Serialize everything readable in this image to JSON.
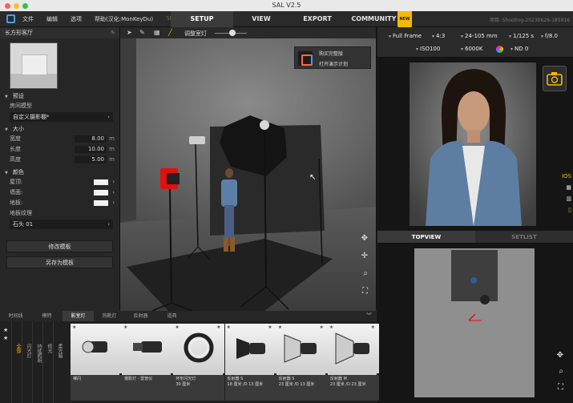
{
  "window": {
    "title": "SAL V2.5"
  },
  "menu": {
    "items": [
      "文件",
      "编辑",
      "选项",
      "帮助(汉化:MonKeyDu)",
      "SFX"
    ]
  },
  "tabs": [
    {
      "label": "SETUP",
      "active": true
    },
    {
      "label": "VIEW",
      "active": false
    },
    {
      "label": "EXPORT",
      "active": false
    },
    {
      "label": "COMMUNITY",
      "active": false,
      "badge": "NEW"
    }
  ],
  "project_name": "项目: Shooting-20230626-185916",
  "left_panel": {
    "header": "长方形客厅",
    "sec_preset": "预设",
    "room_model_label": "房间模型",
    "room_model_value": "自定义摄影棚*",
    "sec_size": "大小",
    "width_label": "宽度",
    "width_value": "8.00",
    "length_label": "长度",
    "length_value": "10.00",
    "height_label": "高度",
    "height_value": "5.00",
    "unit": "m",
    "sec_color": "颜色",
    "ceiling_label": "屋顶:",
    "wall_label": "墙面:",
    "floor_label": "地板:",
    "floor_texture_label": "地板纹理",
    "floor_texture_value": "石头 01",
    "modify_btn": "修改模板",
    "save_as_btn": "另存为模板"
  },
  "viewport": {
    "toolbar_label": "调整室灯",
    "popup_buy": "购买完整版",
    "popup_demo": "打开演示计划"
  },
  "camera_settings": {
    "format": "Full Frame",
    "ratio": "4:3",
    "lens": "24-105 mm",
    "shutter": "1/125 s",
    "aperture": "f/8.0",
    "iso": "ISO100",
    "wb": "6000K",
    "nd": "ND 0"
  },
  "camera_side": {
    "ios": "IOS"
  },
  "right_tabs": [
    {
      "label": "TOPVIEW",
      "active": true
    },
    {
      "label": "SETLIST",
      "active": false
    }
  ],
  "library": {
    "tabs": [
      {
        "label": "时间线",
        "active": false
      },
      {
        "label": "模特",
        "active": false
      },
      {
        "label": "影室灯",
        "active": true
      },
      {
        "label": "热靴灯",
        "active": false
      },
      {
        "label": "反射器",
        "active": false
      },
      {
        "label": "道具",
        "active": false
      }
    ],
    "vertical_tabs": [
      {
        "label": "全部",
        "active": true
      },
      {
        "label": "闪光灯",
        "active": false
      },
      {
        "label": "持续照明",
        "active": false
      },
      {
        "label": "修光",
        "active": false
      },
      {
        "label": "柔光箱",
        "active": false
      }
    ],
    "cards": [
      {
        "line1": "裸闪",
        "line2": "",
        "line3": ""
      },
      {
        "line1": "摄影灯 - 雷普仪",
        "line2": "",
        "line3": ""
      },
      {
        "line1": "环形闪光灯",
        "line2": "30 厘米",
        "line3": ""
      },
      {
        "line1": "反射器 S",
        "line2": "18 厘米 /D 13 厘米",
        "line3": ""
      },
      {
        "line1": "反射器 S",
        "line2": "23 厘米 /D 13 厘米",
        "line3": ""
      },
      {
        "line1": "反射器 M",
        "line2": "23 厘米 /D 23 厘米",
        "line3": ""
      }
    ]
  },
  "colors": {
    "accent_yellow": "#f5b800",
    "modifier_red": "#e01010",
    "app_blue": "#3aa0ff"
  },
  "icons": {
    "toolbar": [
      "cursor-icon",
      "pencil-icon",
      "grid-icon",
      "line-icon"
    ],
    "viewport_nav": [
      "move-icon",
      "pan-icon",
      "zoom-icon",
      "fit-icon"
    ],
    "camera": "camera-icon"
  }
}
